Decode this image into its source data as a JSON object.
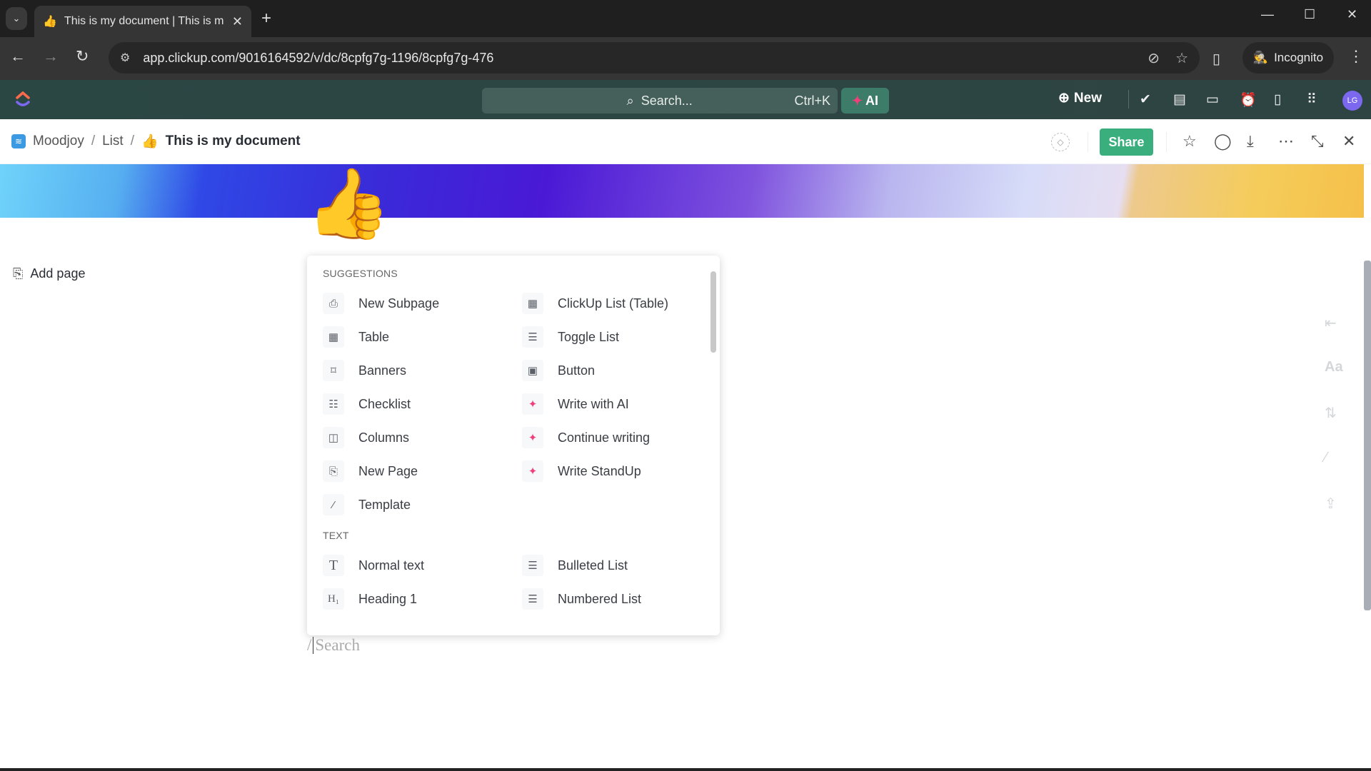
{
  "browser": {
    "tab_title": "This is my document | This is m",
    "tab_favicon": "👍",
    "url": "app.clickup.com/9016164592/v/dc/8cpfg7g-1196/8cpfg7g-476",
    "incognito_label": "Incognito"
  },
  "app_header": {
    "search_placeholder": "Search...",
    "search_shortcut": "Ctrl+K",
    "ai_label": "AI",
    "new_label": "New",
    "avatar_initials": "LG",
    "icons": [
      "check-circle-icon",
      "notepad-icon",
      "video-icon",
      "alarm-icon",
      "doc-icon",
      "apps-grid-icon"
    ]
  },
  "breadcrumb": {
    "workspace": "Moodjoy",
    "list": "List",
    "doc_emoji": "👍",
    "doc_title": "This is my document",
    "share_label": "Share"
  },
  "sidebar": {
    "add_page_label": "Add page"
  },
  "document": {
    "icon_emoji": "👍",
    "slash_prefix": "/",
    "search_placeholder": "Search"
  },
  "slash_menu": {
    "sections": [
      {
        "title": "SUGGESTIONS",
        "items": [
          {
            "label": "New Subpage",
            "icon": "subpage-icon"
          },
          {
            "label": "ClickUp List (Table)",
            "icon": "table-icon"
          },
          {
            "label": "Table",
            "icon": "table-icon"
          },
          {
            "label": "Toggle List",
            "icon": "list-icon"
          },
          {
            "label": "Banners",
            "icon": "bookmark-icon"
          },
          {
            "label": "Button",
            "icon": "button-icon"
          },
          {
            "label": "Checklist",
            "icon": "checklist-icon"
          },
          {
            "label": "Write with AI",
            "icon": "ai-sparkle-icon"
          },
          {
            "label": "Columns",
            "icon": "columns-icon"
          },
          {
            "label": "Continue writing",
            "icon": "ai-sparkle-icon"
          },
          {
            "label": "New Page",
            "icon": "new-page-icon"
          },
          {
            "label": "Write StandUp",
            "icon": "ai-sparkle-icon"
          },
          {
            "label": "Template",
            "icon": "template-wand-icon"
          }
        ]
      },
      {
        "title": "TEXT",
        "items": [
          {
            "label": "Normal text",
            "icon": "text-icon"
          },
          {
            "label": "Bulleted List",
            "icon": "bulleted-list-icon"
          },
          {
            "label": "Heading 1",
            "icon": "heading-icon"
          },
          {
            "label": "Numbered List",
            "icon": "numbered-list-icon"
          }
        ]
      }
    ]
  },
  "colors": {
    "share_green": "#3aaf7d",
    "header_bg": "#2b4744",
    "ai_accent": "#f0407a",
    "avatar_purple": "#7b68ee"
  }
}
